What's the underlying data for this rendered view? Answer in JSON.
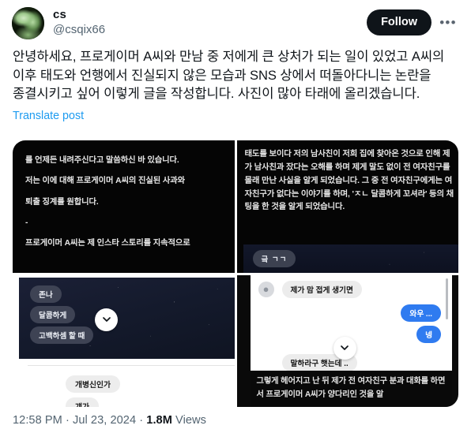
{
  "post": {
    "author": {
      "display_name": "cs",
      "handle": "@csqix66",
      "avatar_alt": "avatar"
    },
    "actions": {
      "follow_label": "Follow",
      "more_label": "•••"
    },
    "body": "안녕하세요, 프로게이머 A씨와 만남 중 저에게 큰 상처가 되는 일이 있었고 A씨의 이후 태도와 언행에서 진실되지 않은 모습과 SNS 상에서 떠돌아다니는 논란을 종결시키고 싶어 이렇게 글을 작성합니다. 사진이 많아 타래에 올리겠습니다.",
    "translate_label": "Translate post",
    "footer": {
      "time": "12:58 PM",
      "separator": "·",
      "date": "Jul 23, 2024",
      "views_count": "1.8M",
      "views_label": "Views"
    }
  },
  "media": {
    "cell1": {
      "line1": "를 언제든 내려주신다고 말씀하신 바 있습니다.",
      "line2": "저는 이에 대해 프로게이머 A씨의 진실된 사과와",
      "line3": "퇴출 징계를 원합니다.",
      "line4": "-",
      "line5": "프로게이머 A씨는 제 인스타 스토리를 지속적으로"
    },
    "cell2": {
      "text": "태도를 보이다 저의 남사친이 저희 집에 찾아온 것으로 인해 제가 남사친과 잤다는 오해를 하며 제게 말도 없이 전 여자친구를 몰래 만난 사실을 알게 되었습니다. 그 중 전 여자친구에게는 여자친구가 없다는 이야기를 하며, 'ㅈㄴ 달콤하게 꼬셔라' 등의 채팅을 한 것을 알게 되었습니다.",
      "bubble": "긐 ㄱㄱ"
    },
    "cell3": {
      "bubble1": "존나",
      "bubble2": "달콤하게",
      "bubble3": "고백하셈 할 때",
      "white_bubble1": "개병신인가",
      "white_bubble2": "걔가"
    },
    "cell4": {
      "bubble_grey1": "제가 맘 접게 생기면",
      "bubble_blue1": "와우 ...",
      "bubble_blue2": "넹",
      "bubble_grey2": "말하라구 햇는데 ..",
      "caption": "그렇게 헤어지고 난 뒤 제가 전 여자친구 분과 대화를 하면서 프로게이머 A씨가 양다리인 것을 알"
    }
  },
  "colors": {
    "accent_blue": "#1d9bf0",
    "chat_blue": "#2f7bf0",
    "text_primary": "#0f1419",
    "text_secondary": "#536471"
  }
}
